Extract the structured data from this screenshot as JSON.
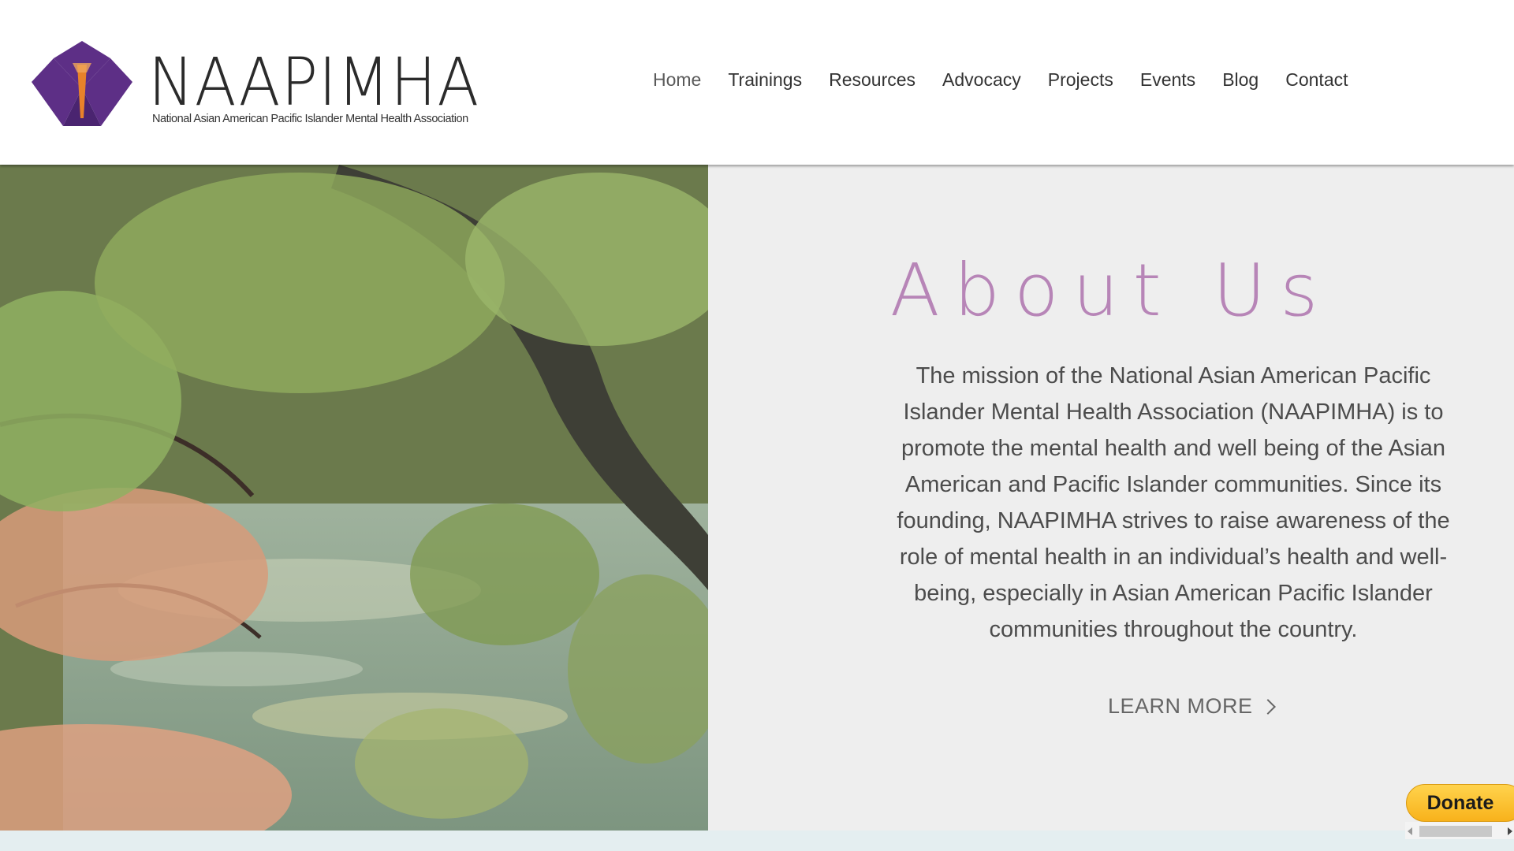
{
  "brand": {
    "name": "NAAPIMHA",
    "tagline": "National Asian American Pacific Islander Mental Health Association",
    "colors": {
      "purple": "#5d2f86",
      "flame": "#e8822a",
      "accent": "#b785b7"
    }
  },
  "nav": {
    "items": [
      {
        "label": "Home"
      },
      {
        "label": "Trainings"
      },
      {
        "label": "Resources"
      },
      {
        "label": "Advocacy"
      },
      {
        "label": "Projects"
      },
      {
        "label": "Events"
      },
      {
        "label": "Blog"
      },
      {
        "label": "Contact"
      }
    ]
  },
  "hero": {
    "image": "autumn-tree-over-pond-photo",
    "title": "About Us",
    "mission": "The mission of the  National Asian American Pacific Islander Mental Health Association (NAAPIMHA) is to promote the mental health and well being of the Asian American and Pacific Islander communities. Since its founding, NAAPIMHA strives to raise awareness of the role of mental health in an individual’s health and well-being, especially in Asian American Pacific Islander communities throughout the country.",
    "cta": "LEARN MORE",
    "cta_icon": "chevron-right-icon"
  },
  "donate": {
    "label": "Donate"
  }
}
